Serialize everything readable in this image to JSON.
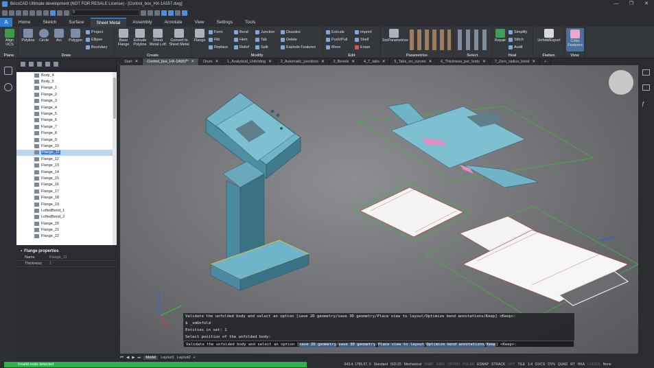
{
  "app": {
    "title": "BricsCAD Ultimate development (NOT FOR RESALE License) - [Control_box_HX-1A557.dwg]",
    "window_controls": [
      "—",
      "❐",
      "✕"
    ]
  },
  "qat": {
    "layer_value": "0"
  },
  "tabs": [
    "Home",
    "Sketch",
    "Surface",
    "Sheet Metal",
    "Assembly",
    "Annotate",
    "View",
    "Settings",
    "Tools"
  ],
  "active_tab": "Sheet Metal",
  "ribbon": {
    "groups": [
      {
        "label": "Plane",
        "buttons": [
          "Align UCS"
        ]
      },
      {
        "label": "Draw",
        "buttons": [
          "Polyline",
          "Circle",
          "Arc",
          "Polygon"
        ],
        "small": [
          "Project",
          "Ellipse",
          "Boundary"
        ]
      },
      {
        "label": "Create",
        "buttons": [
          "Base Flange",
          "Extrude Polyline",
          "Sheet Metal Loft",
          "Convert to Sheet Metal"
        ]
      },
      {
        "label": "Modify",
        "buttons": [
          "Flange"
        ],
        "small": [
          "Form",
          "Rib",
          "Replace",
          "Bend",
          "Hem",
          "Relief",
          "Junction",
          "Tab",
          "Split",
          "Dissolve",
          "Delete",
          "Explode Features"
        ]
      },
      {
        "label": "Edit",
        "small": [
          "Extrude",
          "Push/Pull",
          "Move",
          "Imprint",
          "Shell",
          "Erase"
        ]
      },
      {
        "label": "Parametrize",
        "buttons": [
          "SmParametrize"
        ]
      },
      {
        "label": "Select"
      },
      {
        "label": "Heal",
        "buttons": [
          "Repair"
        ],
        "small": [
          "Simplify",
          "Stitch",
          "Audit"
        ]
      },
      {
        "label": "Flatten",
        "buttons": [
          "Unfold/Export"
        ]
      },
      {
        "label": "View",
        "buttons": [
          "Color Features"
        ]
      }
    ]
  },
  "doc_tabs": [
    "Start",
    "Control_box_HX-1A557*",
    "Drum",
    "1_Analytical_Unfolding",
    "2_Automatic_junctions",
    "3_Bevels",
    "4_T_tabs",
    "5_Tabs_on_curves",
    "6_Thickness_per_body",
    "7_Zero_radius_bend"
  ],
  "active_doc_tab": "Control_box_HX-1A557*",
  "tree": {
    "items": [
      "Body_4",
      "Body_5",
      "Flange_1",
      "Flange_2",
      "Flange_3",
      "Flange_4",
      "Flange_5",
      "Flange_6",
      "Flange_7",
      "Flange_8",
      "Flange_9",
      "Flange_10",
      "Flange_11",
      "Flange_12",
      "Flange_13",
      "Flange_14",
      "Flange_15",
      "Flange_16",
      "Flange_17",
      "Flange_18",
      "Flange_19",
      "LoftedBend_1",
      "LoftedBend_2",
      "Flange_20",
      "Flange_21",
      "Flange_22"
    ],
    "selected": "Flange_11"
  },
  "properties": {
    "title": "Flange properties",
    "rows": [
      {
        "key": "Name",
        "value": "Flange_11"
      },
      {
        "key": "Thickness",
        "value": "1"
      }
    ]
  },
  "command_lines": [
    "Validate the unfolded body and select an option [save 2D geometry/save 3D geometry/Place view to layout/Optimize bend annotations/Keep] <Keep>:",
    "$ _smUnfold",
    "Entities in set: 1",
    "Select position of the unfolded body:"
  ],
  "command_prompt": {
    "prefix": "Validate the unfolded body and select an option",
    "options": [
      "save 2D geometry",
      "save 3D geometry",
      "Place view to layout",
      "Optimize bend annotations",
      "Keep"
    ],
    "default": "<Keep>:"
  },
  "layout_tabs": [
    "Model",
    "Layout1",
    "Layout2"
  ],
  "status": {
    "message": "Invalid node detected",
    "progress": 1.0,
    "coords": "-343.4, 1785.07, 0",
    "items": [
      "Standard",
      "ISO-25",
      "Mechanical",
      "SNAP",
      "GRID",
      "ORTHO",
      "POLAR",
      "ESNAP",
      "STRACK",
      "LWT",
      "TILE",
      "1:4",
      "DUCS",
      "DYN",
      "QUAD",
      "RT",
      "HKA",
      "LOCKUI",
      "None"
    ],
    "off": [
      "SNAP",
      "GRID",
      "ORTHO",
      "POLAR",
      "LWT",
      "LOCKUI"
    ]
  },
  "colors": {
    "accent": "#2f7bd1",
    "sheet": "#5e9fb3",
    "green": "#3fb83f",
    "progress": "#29b34a"
  }
}
